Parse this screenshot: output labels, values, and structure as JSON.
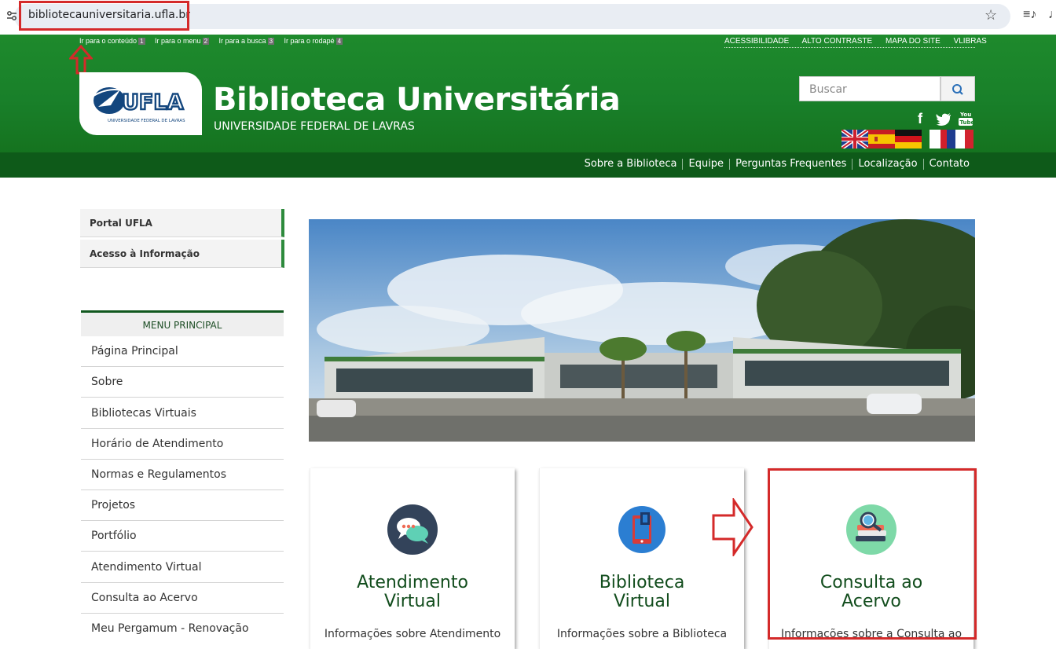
{
  "browser": {
    "url": "bibliotecauniversitaria.ufla.br"
  },
  "skip_links": [
    {
      "label": "Ir para o conteúdo",
      "key": "1"
    },
    {
      "label": "Ir para o menu",
      "key": "2"
    },
    {
      "label": "Ir para a busca",
      "key": "3"
    },
    {
      "label": "Ir para o rodapé",
      "key": "4"
    }
  ],
  "top_links": [
    "ACESSIBILIDADE",
    "ALTO CONTRASTE",
    "MAPA DO SITE",
    "VLIBRAS"
  ],
  "header": {
    "title": "Biblioteca Universitária",
    "subtitle": "UNIVERSIDADE FEDERAL DE LAVRAS",
    "logo_text": "UFLA",
    "logo_caption": "UNIVERSIDADE FEDERAL DE LAVRAS"
  },
  "search": {
    "placeholder": "Buscar"
  },
  "social": [
    "facebook-icon",
    "twitter-icon",
    "youtube-icon"
  ],
  "youtube_label": "You\nTube",
  "languages": [
    "english-flag",
    "spanish-flag",
    "german-flag",
    "italian-flag",
    "french-flag"
  ],
  "nav": [
    "Sobre a Biblioteca",
    "Equipe",
    "Perguntas Frequentes",
    "Localização",
    "Contato"
  ],
  "sidebar": {
    "portal": [
      "Portal UFLA",
      "Acesso à Informação"
    ],
    "menu_title": "MENU PRINCIPAL",
    "menu": [
      "Página Principal",
      "Sobre",
      "Bibliotecas Virtuais",
      "Horário de Atendimento",
      "Normas e Regulamentos",
      "Projetos",
      "Portfólio",
      "Atendimento Virtual",
      "Consulta ao Acervo",
      "Meu Pergamum - Renovação"
    ]
  },
  "cards": [
    {
      "title_l1": "Atendimento",
      "title_l2": "Virtual",
      "desc": "Informações sobre Atendimento",
      "icon": "chat-bubbles-icon"
    },
    {
      "title_l1": "Biblioteca",
      "title_l2": "Virtual",
      "desc": "Informações sobre a Biblioteca",
      "icon": "tablet-book-icon"
    },
    {
      "title_l1": "Consulta ao",
      "title_l2": "Acervo",
      "desc": "Informações sobre a Consulta ao",
      "icon": "books-magnifier-icon"
    }
  ],
  "colors": {
    "header_green": "#19802a",
    "nav_green": "#0e5a19",
    "title_green": "#124d1d",
    "annotation_red": "#d42a2a"
  }
}
